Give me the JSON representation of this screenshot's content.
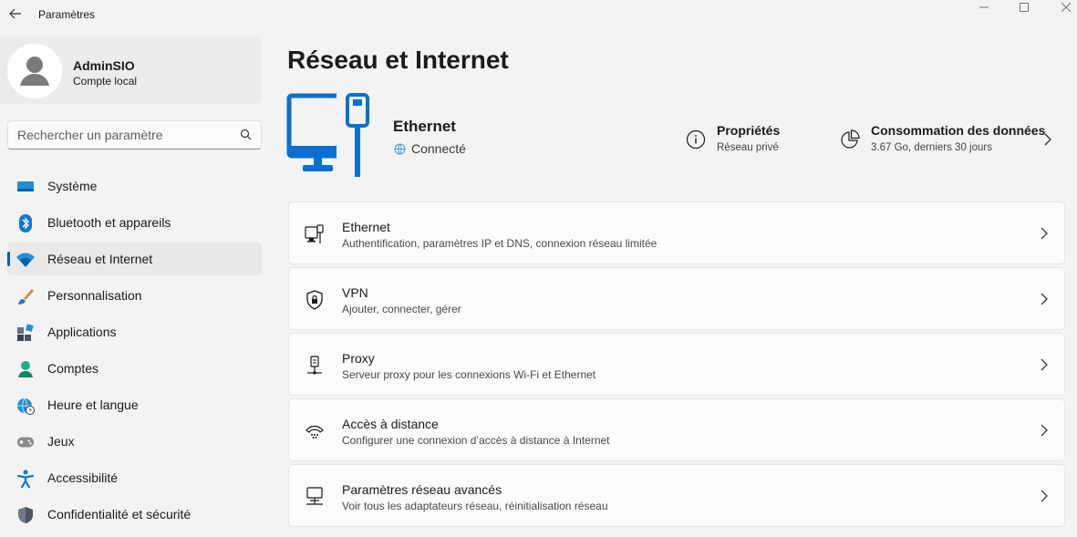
{
  "window": {
    "title": "Paramètres"
  },
  "user": {
    "name": "AdminSIO",
    "type": "Compte local"
  },
  "search": {
    "placeholder": "Rechercher un paramètre"
  },
  "nav": [
    {
      "label": "Système",
      "icon": "monitor-icon"
    },
    {
      "label": "Bluetooth et appareils",
      "icon": "bluetooth-icon"
    },
    {
      "label": "Réseau et Internet",
      "icon": "wifi-icon",
      "active": true
    },
    {
      "label": "Personnalisation",
      "icon": "brush-icon"
    },
    {
      "label": "Applications",
      "icon": "apps-icon"
    },
    {
      "label": "Comptes",
      "icon": "person-icon"
    },
    {
      "label": "Heure et langue",
      "icon": "globe-clock-icon"
    },
    {
      "label": "Jeux",
      "icon": "gamepad-icon"
    },
    {
      "label": "Accessibilité",
      "icon": "accessibility-icon"
    },
    {
      "label": "Confidentialité et sécurité",
      "icon": "shield-icon"
    }
  ],
  "main": {
    "title": "Réseau et Internet",
    "connection": {
      "name": "Ethernet",
      "status": "Connecté"
    },
    "properties": {
      "title": "Propriétés",
      "subtitle": "Réseau privé"
    },
    "usage": {
      "title": "Consommation des données",
      "subtitle": "3.67 Go, derniers 30 jours"
    },
    "cards": [
      {
        "title": "Ethernet",
        "subtitle": "Authentification, paramètres IP et DNS, connexion réseau limitée",
        "icon": "ethernet-icon"
      },
      {
        "title": "VPN",
        "subtitle": "Ajouter, connecter, gérer",
        "icon": "vpn-shield-icon"
      },
      {
        "title": "Proxy",
        "subtitle": "Serveur proxy pour les connexions Wi-Fi et Ethernet",
        "icon": "proxy-icon"
      },
      {
        "title": "Accès à distance",
        "subtitle": "Configurer une connexion d’accès à distance à Internet",
        "icon": "dialup-icon"
      },
      {
        "title": "Paramètres réseau avancés",
        "subtitle": "Voir tous les adaptateurs réseau, réinitialisation réseau",
        "icon": "network-pc-icon"
      }
    ]
  },
  "colors": {
    "accent": "#005fb8",
    "hero_icon": "#0a6fd1",
    "background": "#f3f3f3"
  }
}
